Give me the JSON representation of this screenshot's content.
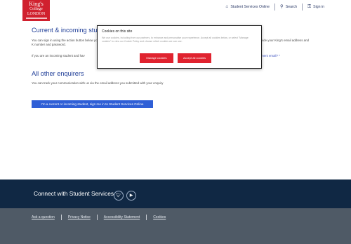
{
  "header": {
    "logo_lines": [
      "King's",
      "College",
      "LONDON"
    ],
    "nav": {
      "student_services": "Student Services Online",
      "search": "Search",
      "sign_in": "Sign in"
    }
  },
  "main": {
    "current_heading": "Current & incoming stu",
    "p1_left": "You can sign in using the action button below your K number and password.",
    "p1_right": "vide your King's email address and",
    "p2_left": "If you are an incoming student and hav",
    "p2_right_link": "ment email? *",
    "other_heading": "All other enquirers",
    "p3": "You can track your communication with us via the email address you submitted with your enquiry",
    "cta_button": "I'm a current or incoming student, sign me in to Student Services Online"
  },
  "cookie": {
    "title": "Cookies on this site",
    "text": "We use cookies, including from our partners, to enhance and personalise your experience. Accept all cookies below, or select \"Manage cookies\" to view our Cookie Policy and choose which cookies we can use.",
    "manage_label": "Manage cookies",
    "accept_label": "Accept all cookies"
  },
  "connect": {
    "title": "Connect with Student Services"
  },
  "footer": {
    "links": [
      "Ask a question",
      "Privacy Notice",
      "Accessibility Statement",
      "Cookies"
    ]
  },
  "colors": {
    "brand_red": "#d0202e",
    "heading_blue": "#1c3b96",
    "cta_blue": "#2f5fd6",
    "connect_navy": "#102844",
    "footer_grey": "#4f5a66"
  }
}
